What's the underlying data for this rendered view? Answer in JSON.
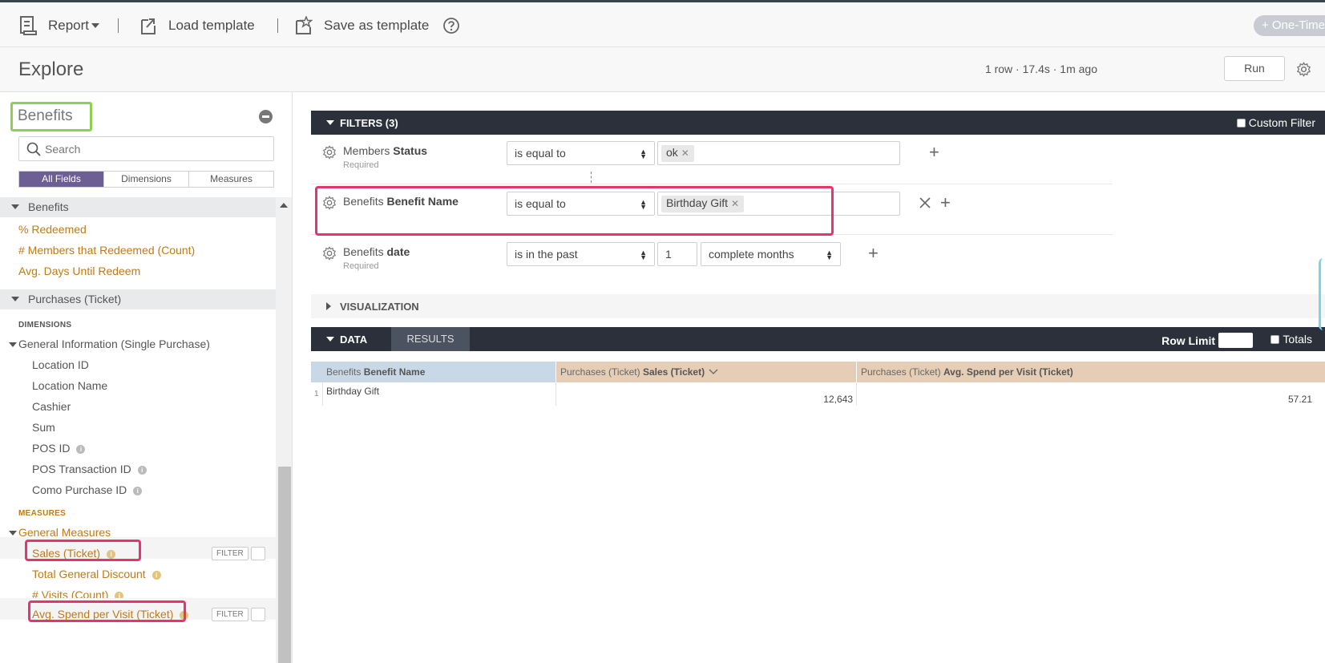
{
  "toolbar": {
    "report_label": "Report",
    "load_template_label": "Load template",
    "save_template_label": "Save as template",
    "help_icon": "question-circle-icon",
    "one_time_label": "+ One-Time"
  },
  "explore": {
    "title": "Explore",
    "run_meta": "1 row · 17.4s · 1m ago",
    "run_label": "Run",
    "settings_icon": "gear-icon"
  },
  "sidebar": {
    "title": "Benefits",
    "search_placeholder": "Search",
    "tabs": [
      "All Fields",
      "Dimensions",
      "Measures"
    ],
    "groups": [
      {
        "name": "Benefits",
        "fields": [
          "% Redeemed",
          "# Members that Redeemed (Count)",
          "Avg. Days Until Redeem"
        ]
      },
      {
        "name": "Purchases (Ticket)",
        "dimensions_header": "DIMENSIONS",
        "dimension_group": "General Information (Single Purchase)",
        "dimensions": [
          "Location ID",
          "Location Name",
          "Cashier",
          "Sum",
          "POS ID",
          "POS Transaction ID",
          "Como Purchase ID"
        ],
        "measures_header": "MEASURES",
        "measure_group": "General Measures",
        "measures": [
          "Sales (Ticket)",
          "Total General Discount",
          "# Visits (Count)",
          "Avg. Spend per Visit (Ticket)"
        ]
      }
    ],
    "filter_button_label": "FILTER"
  },
  "filters": {
    "header": "FILTERS (3)",
    "custom_filter_label": "Custom Filter",
    "rows": [
      {
        "view": "Members",
        "field": "Status",
        "required": "Required",
        "operator": "is equal to",
        "value": "ok"
      },
      {
        "view": "Benefits",
        "field": "Benefit Name",
        "required": "",
        "operator": "is equal to",
        "value": "Birthday Gift"
      },
      {
        "view": "Benefits",
        "field": "date",
        "required": "Required",
        "operator": "is in the past",
        "number": "1",
        "unit": "complete months"
      }
    ]
  },
  "visualization": {
    "label": "VISUALIZATION"
  },
  "data": {
    "label": "DATA",
    "results_label": "RESULTS",
    "row_limit_label": "Row Limit",
    "totals_label": "Totals",
    "columns": [
      {
        "view": "Benefits",
        "field": "Benefit Name"
      },
      {
        "view": "Purchases (Ticket)",
        "field": "Sales (Ticket)"
      },
      {
        "view": "Purchases (Ticket)",
        "field": "Avg. Spend per Visit (Ticket)"
      }
    ],
    "rows": [
      {
        "index": "1",
        "cells": [
          "Birthday Gift",
          "12,643",
          "57.21"
        ]
      }
    ]
  },
  "colors": {
    "accent_purple": "#6c5f94",
    "measure_orange": "#c07a17",
    "dark_bar": "#2b303a",
    "highlight_pink": "#e8336d",
    "highlight_green": "#8fd14f"
  }
}
